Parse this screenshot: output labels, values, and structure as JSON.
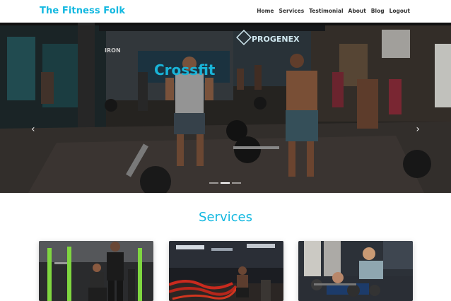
{
  "navbar": {
    "brand": "The Fitness Folk",
    "links": [
      "Home",
      "Services",
      "Testimonial",
      "About",
      "Blog",
      "Logout"
    ]
  },
  "hero": {
    "signage": {
      "logo_text": "PROGENEX",
      "wall_text": "Crossfit",
      "left_sign": "IRON"
    },
    "prev_arrow": "‹",
    "next_arrow": "›",
    "slide_count": 3,
    "active_slide": 2
  },
  "services": {
    "title": "Services",
    "cards": [
      {
        "alt": "trainers-photo"
      },
      {
        "alt": "battle-ropes-photo"
      },
      {
        "alt": "dumbbell-training-photo"
      }
    ]
  },
  "colors": {
    "brand": "#13b8e0",
    "nav_text": "#333333",
    "hero_bg": "#2a2724"
  }
}
